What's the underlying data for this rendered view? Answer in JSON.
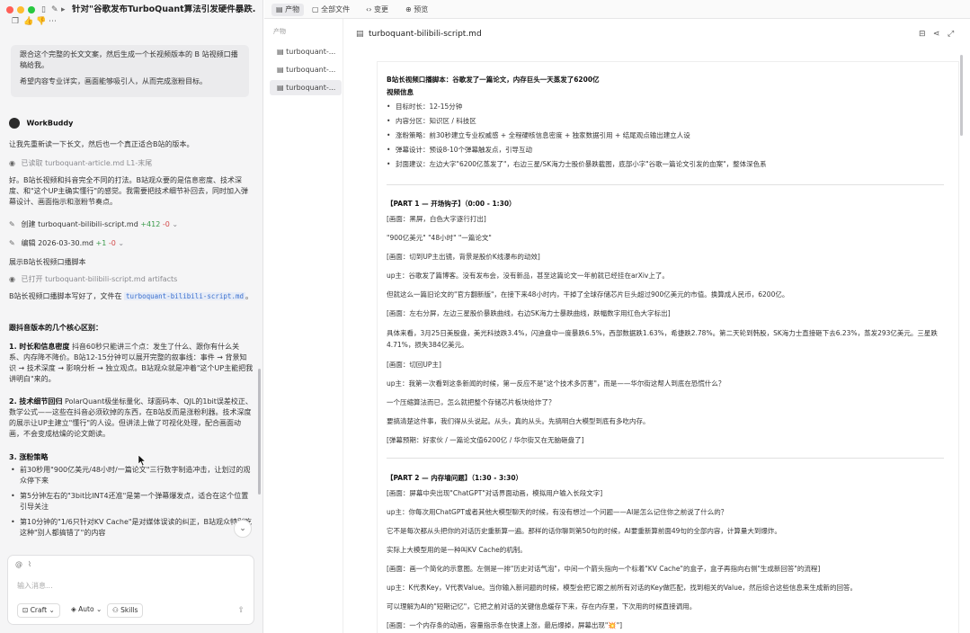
{
  "window": {
    "title": "针对\"谷歌发布TurboQuant算法引发硬件暴跌..."
  },
  "chat": {
    "user_message": [
      "跟合这个完整的长文文案，然后生成一个长视频版本的 B 站视频口播稿给我。",
      "希望内容专业详实，画面能够吸引人，从而完成涨粉目标。"
    ],
    "assistant_name": "WorkBuddy",
    "intro": "让我先重新读一下长文，然后也一个真正适合B站的版本。",
    "read_action": "已读取",
    "read_file": "turboquant-article.md",
    "read_lines": "L1-末尾",
    "analysis": "好。B站长视频和抖音完全不同的打法。B站观众要的是信息密度、技术深度、和\"这个UP主确实懂行\"的感觉。我需要把技术细节补回去，同时加入弹幕设计、画面指示和涨粉节奏点。",
    "create_action": "创建",
    "create_file": "turboquant-bilibili-script.md",
    "create_plus": "+412",
    "create_minus": "-0",
    "edit_action": "编辑",
    "edit_file": "2026-03-30.md",
    "edit_plus": "+1",
    "edit_minus": "-0",
    "show_label": "展示B站长视频口播脚本",
    "opened_action": "已打开",
    "opened_file": "turboquant-bilibili-script.md",
    "opened_tag": "artifacts",
    "done_text": "B站长视频口播脚本写好了，文件在",
    "done_link": "turboquant-bilibili-script.md",
    "done_end": "。",
    "diff_heading": "跟抖音版本的几个核心区别：",
    "point1_title": "1. 时长和信息密度",
    "point1_text": "抖音60秒只能讲三个点：发生了什么、跟你有什么关系、内存降不降价。B站12-15分钟可以展开完整的叙事线：事件 → 背景知识 → 技术深度 → 影响分析 → 独立观点。B站观众就是冲着\"这个UP主能把我讲明白\"来的。",
    "point2_title": "2. 技术细节回归",
    "point2_text": "PolarQuant极坐标量化、球面码本、QJL的1bit误差校正、数学公式——这些在抖音必须砍掉的东西，在B站反而是涨粉利器。技术深度的展示让UP主建立\"懂行\"的人设。但讲法上做了可视化处理，配合画面动画，不会变成枯燥的论文朗读。",
    "point3_title": "3. 涨粉策略",
    "bullets": [
      "前30秒用\"900亿美元/48小时/一篇论文\"三行数字制造冲击，让划过的观众停下来",
      "第5分钟左右的\"3bit比INT4还准\"是第一个弹幕爆发点，适合在这个位置引导关注",
      "第10分钟的\"1/6只针对KV Cache\"是对媒体误读的纠正，B站观众特别吃这种\"别人都搞错了\"的内容"
    ],
    "input_placeholder": "输入消息...",
    "mode_label": "Craft",
    "auto_label": "Auto",
    "skills_label": "Skills"
  },
  "tabs": [
    "产物",
    "全部文件",
    "变更",
    "预览"
  ],
  "files": {
    "header": "产物",
    "items": [
      "turboquant-...",
      "turboquant-...",
      "turboquant-..."
    ]
  },
  "doc": {
    "filename": "turboquant-bilibili-script.md",
    "title": "B站长视频口播脚本：谷歌发了一篇论文，内存巨头一天蒸发了6200亿",
    "info_heading": "视频信息",
    "info": [
      "目标时长：12-15分钟",
      "内容分区：知识区 / 科技区",
      "涨粉策略：前30秒建立专业权威感 + 全程硬核信息密度 + 独家数据引用 + 结尾观点输出建立人设",
      "弹幕设计：预设8-10个弹幕触发点，引导互动",
      "封面建议：左边大字\"6200亿蒸发了\"，右边三星/SK海力士股价暴跌截图，底部小字\"谷歌一篇论文引发的血案\"，整体深色系"
    ],
    "part1_heading": "【PART 1 — 开场钩子】（0:00 - 1:30）",
    "part1": [
      "[画面：黑屏，白色大字逐行打出]",
      "\"900亿美元\" \"48小时\" \"一篇论文\"",
      "[画面：切到UP主出镜，背景是股价K线瀑布的动效]",
      "up主：谷歌发了篇博客。没有发布会，没有新品，甚至这篇论文一年前就已经挂在arXiv上了。",
      "但就这么一篇旧论文的\"官方翻新版\"，在接下来48小时内，干掉了全球存储芯片巨头超过900亿美元的市值。换算成人民币，6200亿。",
      "[画面：左右分屏，左边三星股价暴跌曲线，右边SK海力士暴跌曲线，跌幅数字用红色大字标出]",
      "具体来看，3月25日美股盘，美光科技跌3.4%，闪迪盘中一度暴跌6.5%，西部数据跌1.63%，希捷跌2.78%。第二天轮到韩股，SK海力士直接砸下去6.23%，蒸发293亿美元。三星跌4.71%，损失384亿美元。",
      "[画面：切回UP主]",
      "up主：我第一次看到这条新闻的时候，第一反应不是\"这个技术多厉害\"，而是——华尔街这帮人到底在恐慌什么？",
      "一个压缩算法而已，怎么就把整个存储芯片板块给炸了？",
      "要搞清楚这件事，我们得从头说起。从头，真的从头。先搞明白大模型到底有多吃内存。",
      "[弹幕预期：好家伙 / 一篇论文值6200亿 / 华尔街又在无脑砸盘了]"
    ],
    "part2_heading": "【PART 2 — 内存墙问题】（1:30 - 3:30）",
    "part2": [
      "[画面：屏幕中央出现\"ChatGPT\"对话界面动画，模拟用户输入长段文字]",
      "up主：你每次用ChatGPT或者其他大模型聊天的时候，有没有想过一个问题——AI是怎么记住你之前说了什么的？",
      "它不是每次都从头把你的对话历史重新算一遍。那样的话你聊到第50句的时候，AI要重新算前面49句的全部内容，计算量大到爆炸。",
      "实际上大模型用的是一种叫KV Cache的机制。",
      "[画面：画一个简化的示意图。左侧是一排\"历史对话气泡\"，中间一个箭头指向一个标着\"KV Cache\"的盒子，盒子再指向右侧\"生成新回答\"的流程]",
      "up主：K代表Key，V代表Value。当你输入新问题的时候，模型会把它跟之前所有对话的Key做匹配，找到相关的Value，然后综合这些信息来生成新的回答。",
      "可以理解为AI的\"短期记忆\"，它把之前对话的关键信息缓存下来，存在内存里，下次用的时候直接调用。",
      "[画面：一个内存条的动画，容量指示条在快速上涨，最后爆掉，屏幕出现\"💥\"]"
    ]
  }
}
